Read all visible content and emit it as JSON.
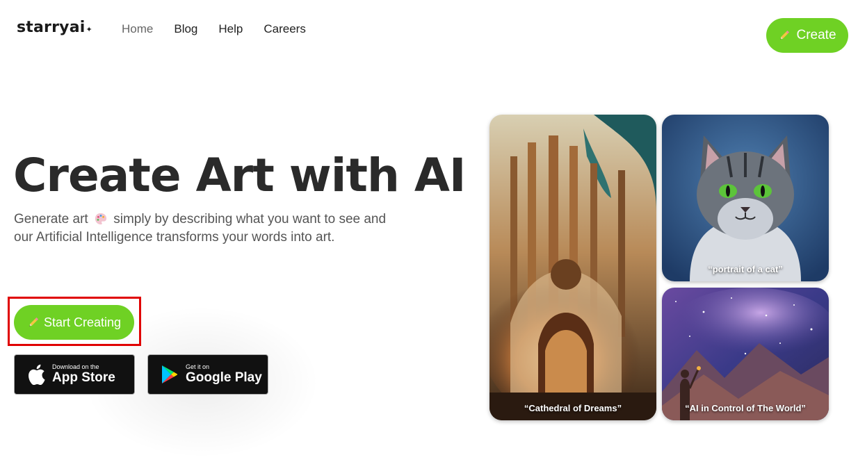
{
  "header": {
    "logo_text": "starryai",
    "logo_mark": "✦",
    "nav": [
      {
        "label": "Home",
        "active": true
      },
      {
        "label": "Blog",
        "active": false
      },
      {
        "label": "Help",
        "active": false
      },
      {
        "label": "Careers",
        "active": false
      }
    ],
    "create_label": "Create"
  },
  "hero": {
    "title": "Create Art with AI",
    "subtitle_part1": "Generate art",
    "subtitle_part2": "simply by describing what you want to see and our Artificial Intelligence transforms your words into art.",
    "start_label": "Start Creating"
  },
  "stores": {
    "app_store": {
      "small": "Download on the",
      "big": "App Store"
    },
    "google_play": {
      "small": "Get it on",
      "big": "Google Play"
    }
  },
  "gallery": [
    {
      "caption": "“Cathedral of Dreams”"
    },
    {
      "caption": "“portrait of a cat”"
    },
    {
      "caption": "“AI in Control of The World”"
    }
  ],
  "colors": {
    "accent": "#6fd124",
    "highlight": "#e00000",
    "title": "#2a2a2a",
    "store_bg": "#111111"
  },
  "icons": [
    "pencil-icon",
    "palette-icon",
    "apple-icon",
    "google-play-icon",
    "sparkle-icon"
  ]
}
